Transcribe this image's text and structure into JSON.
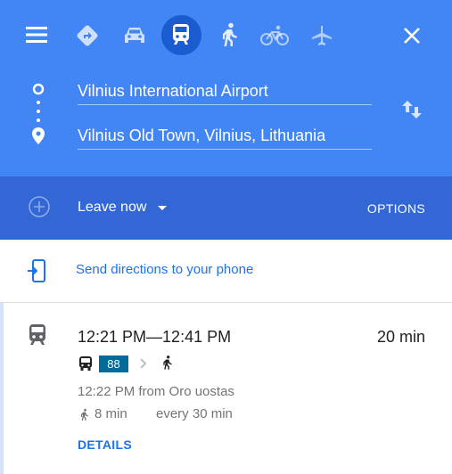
{
  "header": {
    "menu_icon": "menu-icon",
    "modes": [
      {
        "name": "best-route",
        "icon": "directions-diamond-icon",
        "active": false
      },
      {
        "name": "driving",
        "icon": "car-icon",
        "active": false
      },
      {
        "name": "transit",
        "icon": "train-icon",
        "active": true
      },
      {
        "name": "walking",
        "icon": "walking-icon",
        "active": false
      },
      {
        "name": "cycling",
        "icon": "bicycle-icon",
        "active": false
      },
      {
        "name": "flights",
        "icon": "airplane-icon",
        "active": false
      }
    ],
    "close_icon": "close-icon"
  },
  "search": {
    "origin": "Vilnius International Airport",
    "destination": "Vilnius Old Town, Vilnius, Lithuania",
    "swap_icon": "swap-icon"
  },
  "leave_bar": {
    "leave_label": "Leave now",
    "options_label": "OPTIONS"
  },
  "send": {
    "label": "Send directions to your phone"
  },
  "route": {
    "time_range": "12:21 PM—12:41 PM",
    "duration": "20 min",
    "bus_number": "88",
    "departure": "12:22 PM from Oro uostas",
    "walk_time": "8 min",
    "frequency": "every 30 min",
    "details_label": "DETAILS"
  },
  "colors": {
    "header_blue": "#4285f4",
    "leave_bar_blue": "#3367d6",
    "active_mode_bg": "#1a5cd0",
    "link_blue": "#1a73e8",
    "bus_badge": "#006b99"
  }
}
